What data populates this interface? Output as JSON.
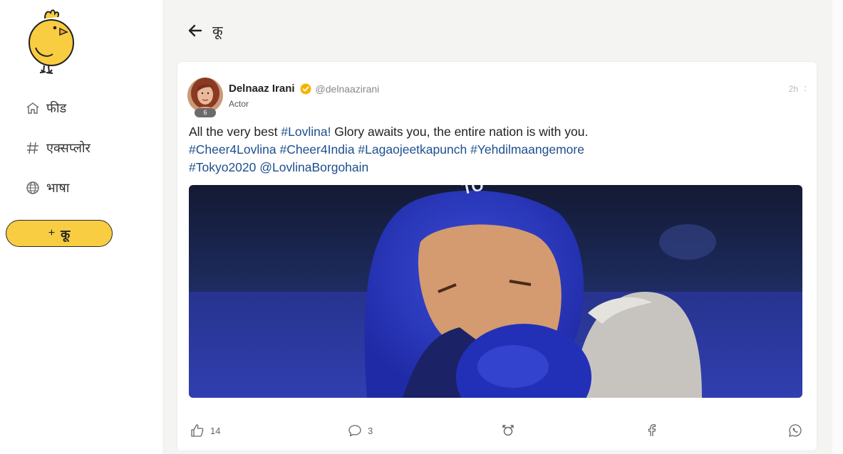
{
  "sidebar": {
    "nav": [
      {
        "label": "फीड",
        "icon": "home-icon"
      },
      {
        "label": "एक्सप्लोर",
        "icon": "hashtag-icon"
      },
      {
        "label": "भाषा",
        "icon": "globe-icon"
      }
    ],
    "koo_button": {
      "plus": "+",
      "label": "कू"
    }
  },
  "header": {
    "title": "कू"
  },
  "post": {
    "author_name": "Delnaaz Irani",
    "handle": "@delnaazirani",
    "role": "Actor",
    "avatar_badge": "6",
    "time": "2h",
    "more": ":",
    "text_plain_1": "All the very best ",
    "hashtag_lovlina": "#Lovlina!",
    "text_plain_2": " Glory awaits you, the entire nation is with you.",
    "hashtags_line2": [
      "#Cheer4Lovlina",
      "#Cheer4India",
      "#Lagaojeetkapunch",
      "#Yehdilmaangemore"
    ],
    "hashtags_line3": [
      "#Tokyo2020",
      "@LovlinaBorgohain"
    ],
    "likes": "14",
    "comments": "3"
  },
  "colors": {
    "accent_yellow": "#f9cd41",
    "hashtag_blue": "#1d4f8f",
    "verified": "#f5b400"
  }
}
